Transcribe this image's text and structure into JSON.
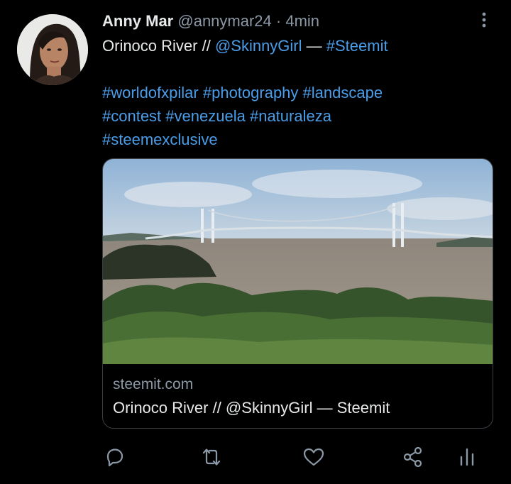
{
  "tweet": {
    "author_name": "Anny Mar",
    "handle": "@annymar24",
    "separator": "·",
    "time": "4min",
    "text_title": "Orinoco River // ",
    "mention": "@SkinnyGirl",
    "dash": " — ",
    "hashtag_main": "#Steemit",
    "hashtags": [
      "#worldofxpilar",
      "#photography",
      "#landscape",
      "#contest",
      "#venezuela",
      "#naturaleza",
      "#steemexclusive"
    ]
  },
  "card": {
    "domain": "steemit.com",
    "title": "Orinoco River // @SkinnyGirl — Steemit"
  },
  "actions": [
    "reply-icon",
    "retweet-icon",
    "like-icon",
    "share-icon",
    "analytics-icon"
  ],
  "colors": {
    "link": "#4a9de8",
    "muted": "#8b98a5",
    "text": "#e7e9ea",
    "background": "#000000"
  }
}
